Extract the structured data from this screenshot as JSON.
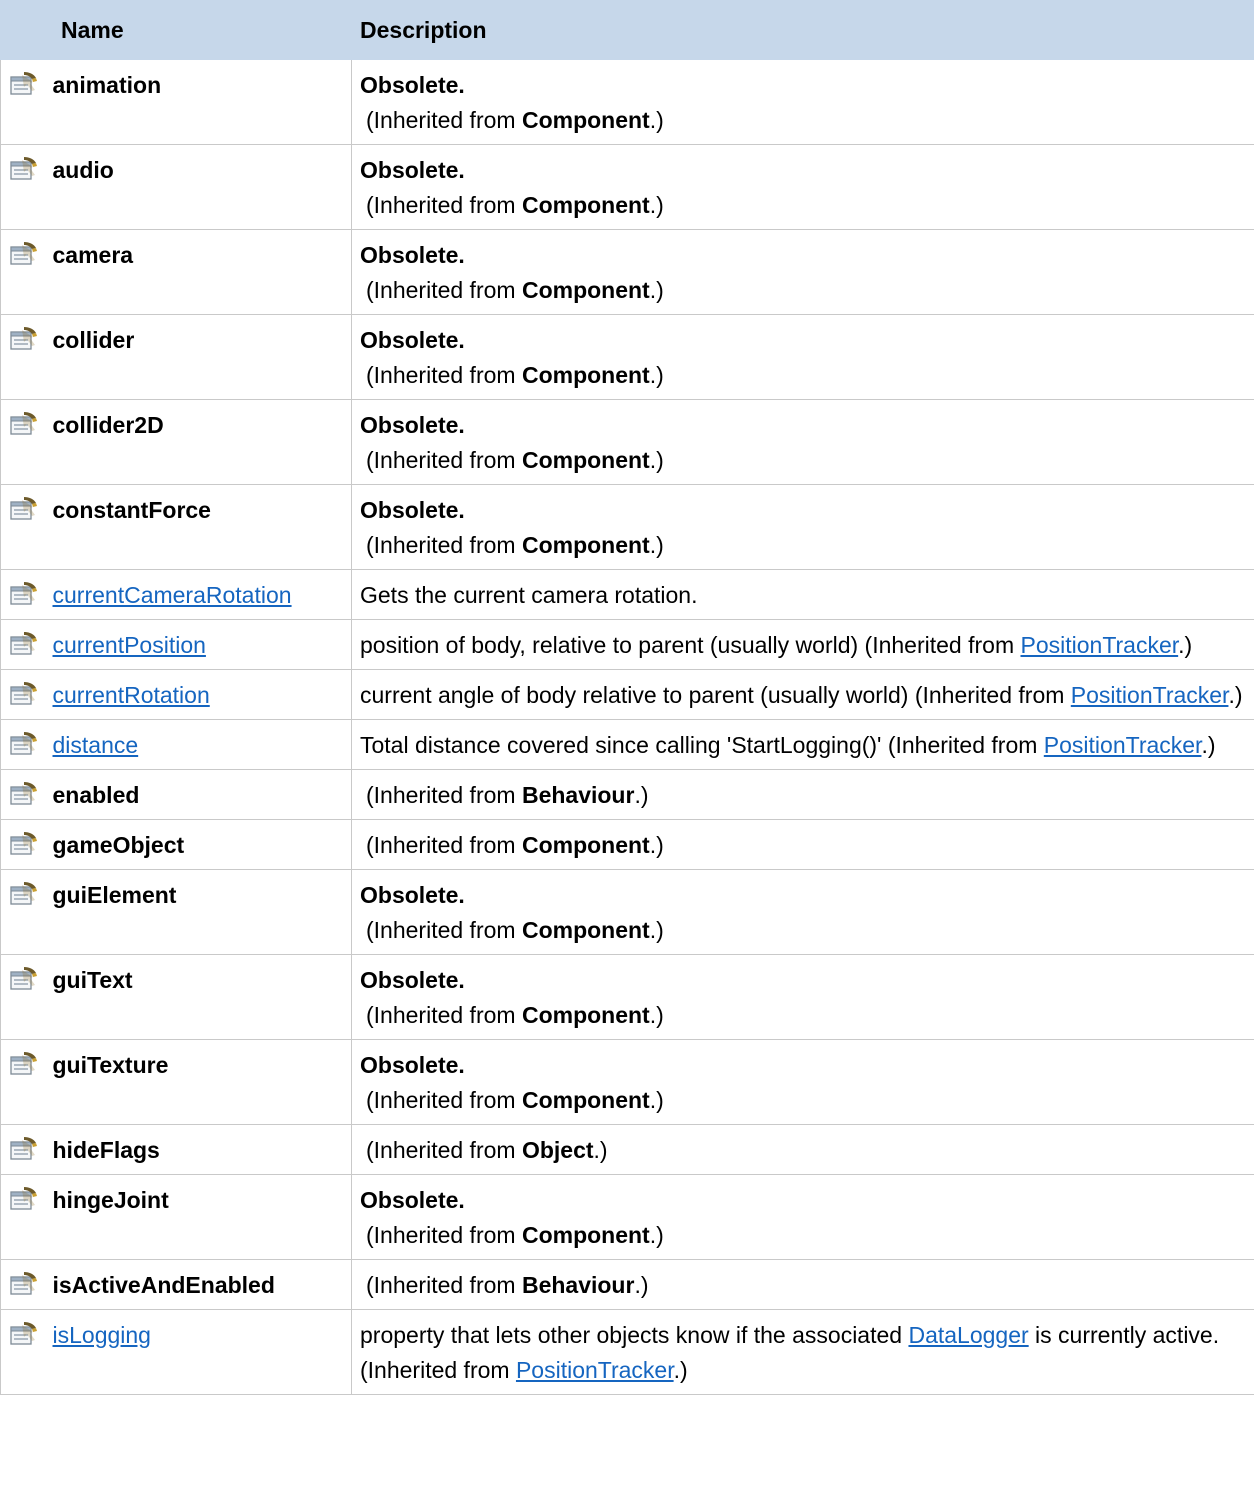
{
  "table": {
    "headers": {
      "icon": "",
      "name": "Name",
      "description": "Description"
    },
    "rows": [
      {
        "name": "animation",
        "link": false,
        "desc": {
          "type": "obsolete",
          "obsolete": "Obsolete.",
          "pre": "(Inherited from ",
          "bold": "Component",
          "post": ".)"
        }
      },
      {
        "name": "audio",
        "link": false,
        "desc": {
          "type": "obsolete",
          "obsolete": "Obsolete.",
          "pre": "(Inherited from ",
          "bold": "Component",
          "post": ".)"
        }
      },
      {
        "name": "camera",
        "link": false,
        "desc": {
          "type": "obsolete",
          "obsolete": "Obsolete.",
          "pre": "(Inherited from ",
          "bold": "Component",
          "post": ".)"
        }
      },
      {
        "name": "collider",
        "link": false,
        "desc": {
          "type": "obsolete",
          "obsolete": "Obsolete.",
          "pre": "(Inherited from ",
          "bold": "Component",
          "post": ".)"
        }
      },
      {
        "name": "collider2D",
        "link": false,
        "desc": {
          "type": "obsolete",
          "obsolete": "Obsolete.",
          "pre": "(Inherited from ",
          "bold": "Component",
          "post": ".)"
        }
      },
      {
        "name": "constantForce",
        "link": false,
        "desc": {
          "type": "obsolete",
          "obsolete": "Obsolete.",
          "pre": "(Inherited from ",
          "bold": "Component",
          "post": ".)"
        }
      },
      {
        "name": "currentCameraRotation",
        "link": true,
        "desc": {
          "type": "plain",
          "text": "Gets the current camera rotation."
        }
      },
      {
        "name": "currentPosition",
        "link": true,
        "desc": {
          "type": "linked",
          "text": "position of body, relative to parent (usually world) (Inherited from ",
          "linktext": "PositionTracker",
          "post": ".)"
        }
      },
      {
        "name": "currentRotation",
        "link": true,
        "desc": {
          "type": "linked",
          "text": "current angle of body relative to parent (usually world) (Inherited from ",
          "linktext": "PositionTracker",
          "post": ".)"
        }
      },
      {
        "name": "distance",
        "link": true,
        "desc": {
          "type": "linked",
          "text": "Total distance covered since calling 'StartLogging()' (Inherited from ",
          "linktext": "PositionTracker",
          "post": ".)"
        }
      },
      {
        "name": "enabled",
        "link": false,
        "desc": {
          "type": "inherited",
          "pre": "(Inherited from ",
          "bold": "Behaviour",
          "post": ".)"
        }
      },
      {
        "name": "gameObject",
        "link": false,
        "desc": {
          "type": "inherited",
          "pre": "(Inherited from ",
          "bold": "Component",
          "post": ".)"
        }
      },
      {
        "name": "guiElement",
        "link": false,
        "desc": {
          "type": "obsolete",
          "obsolete": "Obsolete.",
          "pre": "(Inherited from ",
          "bold": "Component",
          "post": ".)"
        }
      },
      {
        "name": "guiText",
        "link": false,
        "desc": {
          "type": "obsolete",
          "obsolete": "Obsolete.",
          "pre": "(Inherited from ",
          "bold": "Component",
          "post": ".)"
        }
      },
      {
        "name": "guiTexture",
        "link": false,
        "desc": {
          "type": "obsolete",
          "obsolete": "Obsolete.",
          "pre": "(Inherited from ",
          "bold": "Component",
          "post": ".)"
        }
      },
      {
        "name": "hideFlags",
        "link": false,
        "desc": {
          "type": "inherited",
          "pre": "(Inherited from ",
          "bold": "Object",
          "post": ".)"
        }
      },
      {
        "name": "hingeJoint",
        "link": false,
        "desc": {
          "type": "obsolete",
          "obsolete": "Obsolete.",
          "pre": "(Inherited from ",
          "bold": "Component",
          "post": ".)"
        }
      },
      {
        "name": "isActiveAndEnabled",
        "link": false,
        "desc": {
          "type": "inherited",
          "pre": "(Inherited from ",
          "bold": "Behaviour",
          "post": ".)"
        }
      },
      {
        "name": "isLogging",
        "link": true,
        "desc": {
          "type": "islogging",
          "text1": "property that lets other objects know if the associated ",
          "link1": "DataLogger",
          "text2": " is currently active. (Inherited from ",
          "link2": "PositionTracker",
          "post": ".)"
        }
      }
    ]
  },
  "icon": "property-icon",
  "colors": {
    "header_bg": "#c6d7ea",
    "link": "#1565c0",
    "border": "#c9c9c9"
  }
}
